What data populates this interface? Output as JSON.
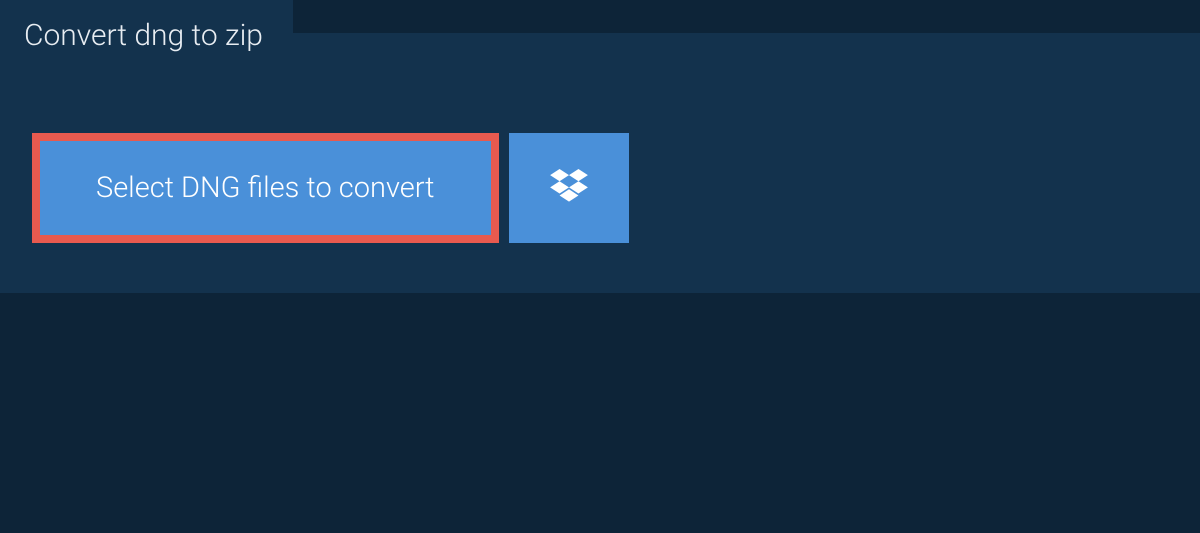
{
  "tab": {
    "title": "Convert dng to zip"
  },
  "actions": {
    "select_label": "Select DNG files to convert"
  },
  "colors": {
    "page_bg": "#0d2438",
    "panel_bg": "#13324d",
    "button_bg": "#4a90d9",
    "highlight_border": "#e85a4f",
    "text_light": "#e8edf2"
  }
}
